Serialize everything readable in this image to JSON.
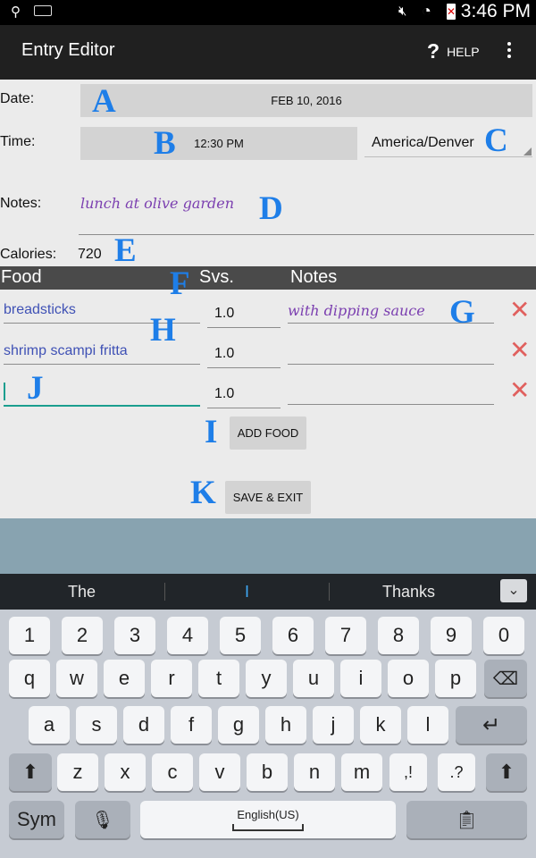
{
  "status": {
    "time": "3:46 PM"
  },
  "actionbar": {
    "title": "Entry Editor",
    "help_label": "HELP"
  },
  "form": {
    "date_label": "Date:",
    "date_value": "FEB 10, 2016",
    "time_label": "Time:",
    "time_value": "12:30 PM",
    "timezone": "America/Denver",
    "notes_label": "Notes:",
    "notes_value": "lunch at olive garden",
    "calories_label": "Calories:",
    "calories_value": "720"
  },
  "table": {
    "headers": [
      "Food",
      "Svs.",
      "Notes"
    ],
    "rows": [
      {
        "food": "breadsticks",
        "svs": "1.0",
        "notes": "with dipping sauce"
      },
      {
        "food": "shrimp scampi fritta",
        "svs": "1.0",
        "notes": ""
      },
      {
        "food": "",
        "svs": "1.0",
        "notes": ""
      }
    ]
  },
  "buttons": {
    "add_food": "ADD FOOD",
    "save_exit": "SAVE & EXIT"
  },
  "markers": {
    "a": "A",
    "b": "B",
    "c": "C",
    "d": "D",
    "e": "E",
    "f": "F",
    "g": "G",
    "h": "H",
    "i": "I",
    "j": "J",
    "k": "K"
  },
  "keyboard": {
    "suggestions": [
      "The",
      "I",
      "Thanks"
    ],
    "row_numbers": [
      "1",
      "2",
      "3",
      "4",
      "5",
      "6",
      "7",
      "8",
      "9",
      "0"
    ],
    "row_q": [
      "q",
      "w",
      "e",
      "r",
      "t",
      "y",
      "u",
      "i",
      "o",
      "p"
    ],
    "row_a": [
      "a",
      "s",
      "d",
      "f",
      "g",
      "h",
      "j",
      "k",
      "l"
    ],
    "row_z": [
      "z",
      "x",
      "c",
      "v",
      "b",
      "n",
      "m"
    ],
    "comma_key": ",!",
    "period_key": ".?",
    "sym_label": "Sym",
    "space_label": "English(US)"
  },
  "colors": {
    "accent": "#1e7ee8",
    "notes_text": "#7b3fb0",
    "food_text": "#3f51b5",
    "delete_x": "#e0605e",
    "cursor": "#1a9e8f"
  }
}
